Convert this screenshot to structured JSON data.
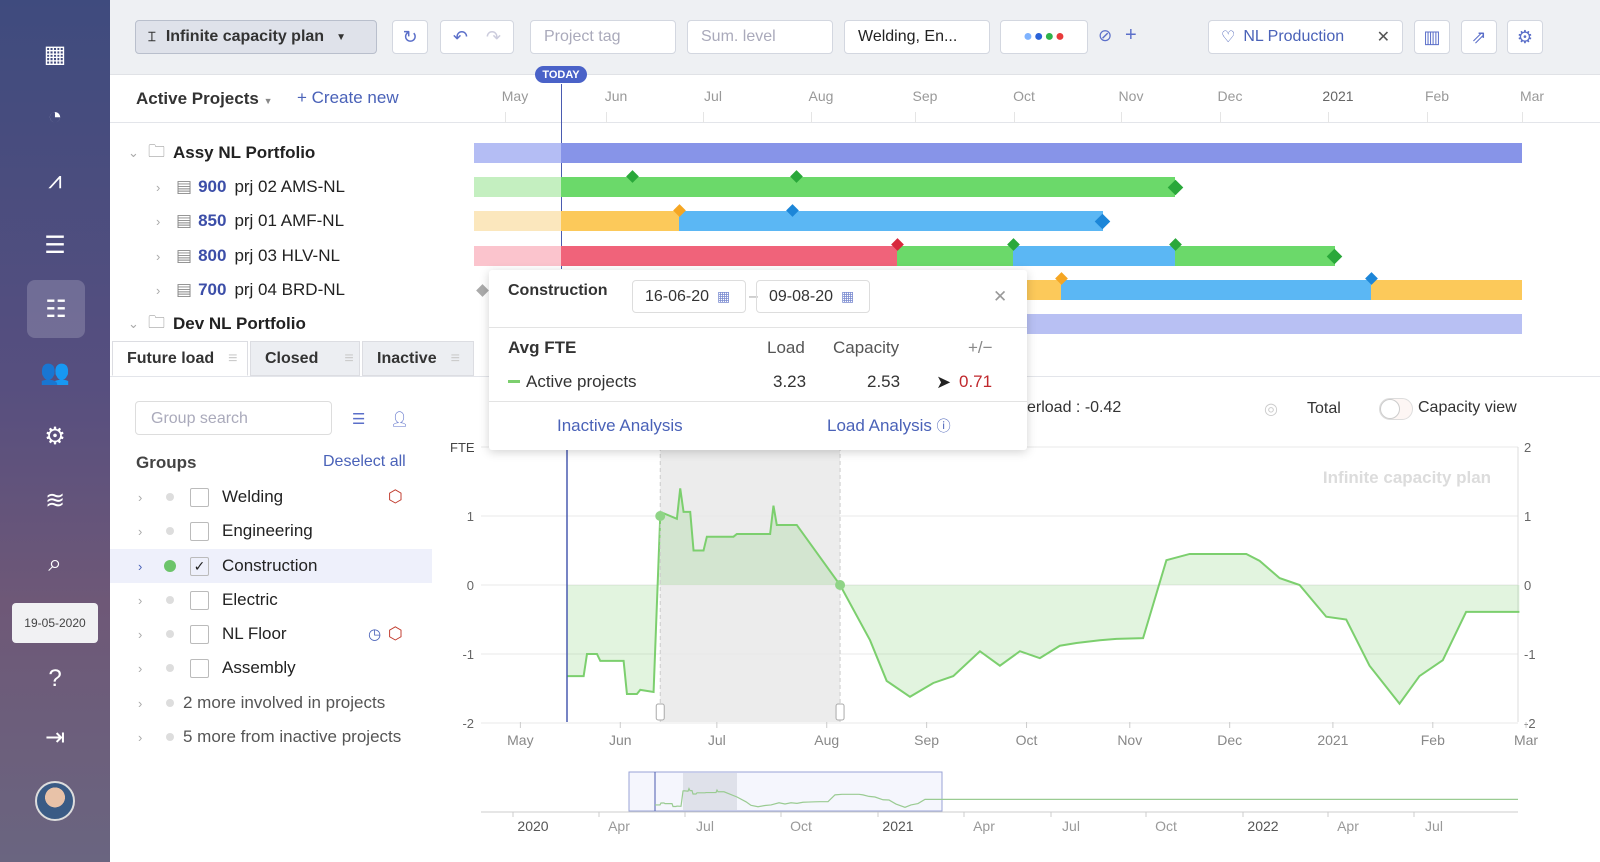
{
  "sidebar": {
    "items": [
      "grid-icon",
      "dashboard-icon",
      "activity-icon",
      "list-icon",
      "gantt-icon",
      "users-icon",
      "settings-icon",
      "layers-icon",
      "analysis-icon"
    ],
    "date": "19-05-2020"
  },
  "toolbar": {
    "plan_select": "Infinite capacity plan",
    "project_tag_placeholder": "Project tag",
    "sum_level_placeholder": "Sum. level",
    "groups_value": "Welding, En...",
    "filter_preset": "NL Production",
    "add": "+",
    "color_dots": [
      "#7fb3ff",
      "#2a62d8",
      "#2fb34a",
      "#e83b3b"
    ]
  },
  "gantt": {
    "view_select": "Active Projects",
    "create_new": "Create new",
    "today": "TODAY",
    "months": [
      "May",
      "Jun",
      "Jul",
      "Aug",
      "Sep",
      "Oct",
      "Nov",
      "Dec",
      "2021",
      "Feb",
      "Mar"
    ],
    "portfolios": [
      {
        "name": "Assy NL Portfolio",
        "projects": [
          {
            "num": "900",
            "name": "prj 02 AMS-NL"
          },
          {
            "num": "850",
            "name": "prj 01 AMF-NL"
          },
          {
            "num": "800",
            "name": "prj 03 HLV-NL"
          },
          {
            "num": "700",
            "name": "prj 04 BRD-NL"
          }
        ]
      },
      {
        "name": "Dev NL Portfolio"
      }
    ]
  },
  "tabs": [
    "Future load",
    "Closed",
    "Inactive"
  ],
  "groups": {
    "search_placeholder": "Group search",
    "title": "Groups",
    "deselect_all": "Deselect all",
    "items": [
      {
        "label": "Welding",
        "checked": false
      },
      {
        "label": "Engineering",
        "checked": false
      },
      {
        "label": "Construction",
        "checked": true
      },
      {
        "label": "Electric",
        "checked": false
      },
      {
        "label": "NL Floor",
        "checked": false
      },
      {
        "label": "Assembly",
        "checked": false
      }
    ],
    "more1": "2 more involved in projects",
    "more2": "5 more from inactive projects"
  },
  "popup": {
    "title": "Construction",
    "date_from": "16-06-20",
    "date_sep": "–",
    "date_to": "09-08-20",
    "col_label": "Avg FTE",
    "col_load": "Load",
    "col_capacity": "Capacity",
    "col_diff": "+/−",
    "row_label": "Active projects",
    "load": "3.23",
    "capacity": "2.53",
    "diff": "0.71",
    "inactive_analysis": "Inactive Analysis",
    "load_analysis": "Load Analysis"
  },
  "chart_controls": {
    "overload": "erload : -0.42",
    "total": "Total",
    "capacity_view": "Capacity view",
    "capacity_view_on": false
  },
  "chart_data": {
    "type": "area",
    "ylabel": "FTE",
    "watermark": "Infinite capacity plan",
    "ylim": [
      -2,
      2
    ],
    "yticks": [
      "2",
      "1",
      "0",
      "-1",
      "-2"
    ],
    "xticks": [
      "May",
      "Jun",
      "Jul",
      "Aug",
      "Sep",
      "Oct",
      "Nov",
      "Dec",
      "2021",
      "Feb",
      "Mar"
    ],
    "today": "2020-05-19",
    "selection": [
      "2020-06-16",
      "2020-08-09"
    ],
    "color": "#7ccf6e",
    "grid": true,
    "x": [
      "2020-05-19",
      "2020-05-24",
      "2020-05-25",
      "2020-05-28",
      "2020-05-29",
      "2020-06-05",
      "2020-06-06",
      "2020-06-09",
      "2020-06-10",
      "2020-06-14",
      "2020-06-16",
      "2020-06-17",
      "2020-06-21",
      "2020-06-22",
      "2020-06-23",
      "2020-06-25",
      "2020-06-26",
      "2020-06-29",
      "2020-06-30",
      "2020-07-08",
      "2020-07-09",
      "2020-07-19",
      "2020-07-20",
      "2020-07-21",
      "2020-07-27",
      "2020-08-09",
      "2020-08-18",
      "2020-08-23",
      "2020-08-30",
      "2020-09-06",
      "2020-09-12",
      "2020-09-20",
      "2020-09-26",
      "2020-10-02",
      "2020-10-08",
      "2020-10-14",
      "2020-10-19",
      "2020-10-26",
      "2020-10-31",
      "2020-11-08",
      "2020-11-15",
      "2020-11-22",
      "2020-12-09",
      "2020-12-13",
      "2020-12-19",
      "2020-12-25",
      "2021-01-02",
      "2021-01-08",
      "2021-01-15",
      "2021-01-24",
      "2021-01-30",
      "2021-02-06",
      "2021-02-13",
      "2021-03-01"
    ],
    "y": [
      -1.32,
      -1.32,
      -1.0,
      -1.0,
      -1.1,
      -1.1,
      -1.58,
      -1.58,
      -1.52,
      -1.55,
      1.0,
      1.04,
      0.96,
      1.4,
      1.06,
      1.06,
      0.5,
      0.5,
      0.7,
      0.7,
      0.74,
      0.74,
      1.15,
      0.87,
      0.87,
      0.0,
      -0.8,
      -1.39,
      -1.62,
      -1.42,
      -1.32,
      -0.96,
      -1.17,
      -0.96,
      -1.06,
      -0.88,
      -0.84,
      -0.8,
      -0.78,
      -0.77,
      0.36,
      0.45,
      0.45,
      0.35,
      0.1,
      0.0,
      -0.46,
      -0.5,
      -1.17,
      -1.72,
      -1.32,
      -1.09,
      -0.39,
      -0.39
    ],
    "navigator": {
      "xticks": [
        "2020",
        "Apr",
        "Jul",
        "Oct",
        "2021",
        "Apr",
        "Jul",
        "Oct",
        "2022",
        "Apr",
        "Jul"
      ]
    }
  }
}
